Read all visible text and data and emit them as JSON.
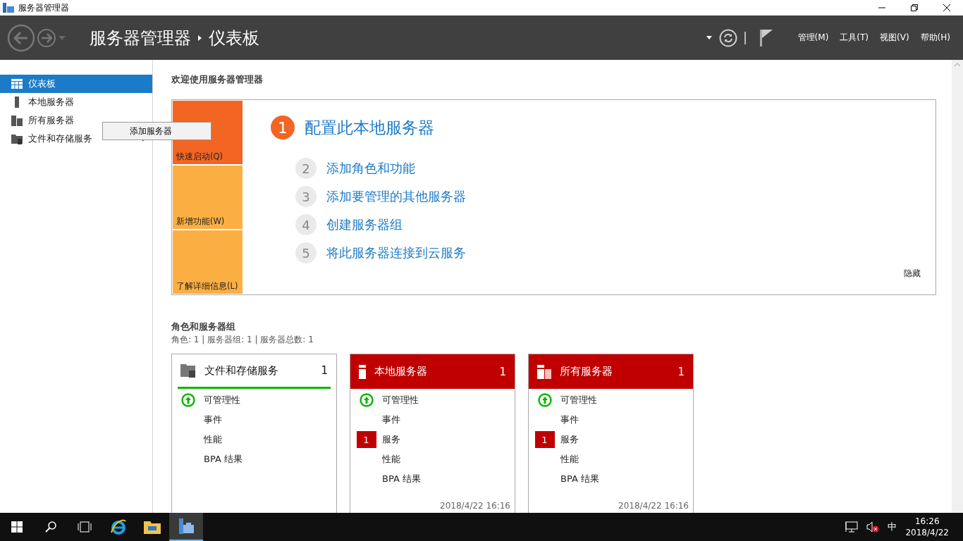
{
  "window": {
    "title": "服务器管理器"
  },
  "header": {
    "breadcrumb": [
      "服务器管理器",
      "仪表板"
    ],
    "menus": [
      "管理(M)",
      "工具(T)",
      "视图(V)",
      "帮助(H)"
    ]
  },
  "sidebar": {
    "items": [
      {
        "label": "仪表板",
        "kind": "dashboard",
        "selected": true,
        "submenu": false
      },
      {
        "label": "本地服务器",
        "kind": "local",
        "selected": false,
        "submenu": false
      },
      {
        "label": "所有服务器",
        "kind": "all",
        "selected": false,
        "submenu": false
      },
      {
        "label": "文件和存储服务",
        "kind": "files",
        "selected": false,
        "submenu": true
      }
    ]
  },
  "context_menu": {
    "items": [
      "添加服务器"
    ]
  },
  "welcome": {
    "title": "欢迎使用服务器管理器",
    "tiles": [
      {
        "label": "快速启动(Q)",
        "selected": true
      },
      {
        "label": "新增功能(W)",
        "selected": false
      },
      {
        "label": "了解详细信息(L)",
        "selected": false
      }
    ],
    "steps": [
      {
        "number": "1",
        "label": "配置此本地服务器",
        "selected": true
      },
      {
        "number": "2",
        "label": "添加角色和功能",
        "selected": false
      },
      {
        "number": "3",
        "label": "添加要管理的其他服务器",
        "selected": false
      },
      {
        "number": "4",
        "label": "创建服务器组",
        "selected": false
      },
      {
        "number": "5",
        "label": "将此服务器连接到云服务",
        "selected": false
      }
    ],
    "hide_link": "隐藏"
  },
  "roles": {
    "title": "角色和服务器组",
    "summary": "角色: 1 | 服务器组: 1 | 服务器总数: 1",
    "cards": [
      {
        "title": "文件和存储服务",
        "count": "1",
        "kind": "files",
        "alert": false,
        "rows": [
          {
            "label": "可管理性",
            "healthy": true
          },
          {
            "label": "事件"
          },
          {
            "label": "性能"
          },
          {
            "label": "BPA 结果"
          }
        ]
      },
      {
        "title": "本地服务器",
        "count": "1",
        "kind": "local",
        "alert": true,
        "timestamp": "2018/4/22 16:16",
        "rows": [
          {
            "label": "可管理性",
            "healthy": true
          },
          {
            "label": "事件"
          },
          {
            "label": "服务",
            "badge": "1"
          },
          {
            "label": "性能"
          },
          {
            "label": "BPA 结果"
          }
        ]
      },
      {
        "title": "所有服务器",
        "count": "1",
        "kind": "all",
        "alert": true,
        "timestamp": "2018/4/22 16:16",
        "rows": [
          {
            "label": "可管理性",
            "healthy": true
          },
          {
            "label": "事件"
          },
          {
            "label": "服务",
            "badge": "1"
          },
          {
            "label": "性能"
          },
          {
            "label": "BPA 结果"
          }
        ]
      }
    ]
  },
  "taskbar": {
    "ime": "中",
    "time": "16:26",
    "date": "2018/4/22"
  }
}
